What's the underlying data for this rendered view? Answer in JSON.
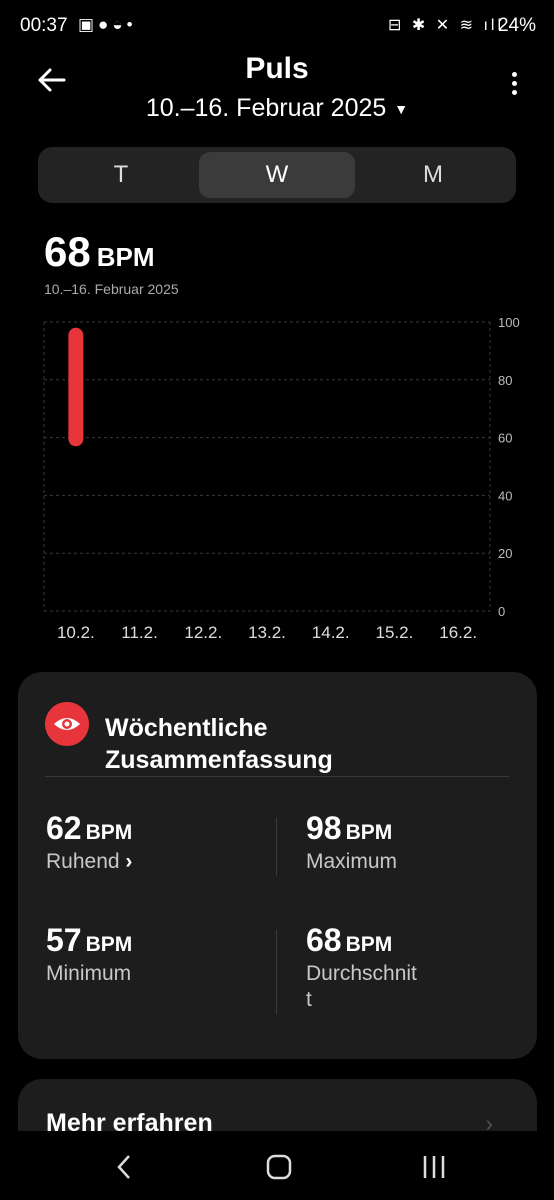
{
  "status": {
    "time": "00:37",
    "battery": "24%"
  },
  "header": {
    "title": "Puls",
    "date_range": "10.–16. Februar 2025"
  },
  "segments": [
    "T",
    "W",
    "M"
  ],
  "summary": {
    "value": "68",
    "unit": "BPM",
    "subtitle": "10.–16. Februar 2025"
  },
  "chart_data": {
    "type": "bar",
    "categories": [
      "10.2.",
      "11.2.",
      "12.2.",
      "13.2.",
      "14.2.",
      "15.2.",
      "16.2."
    ],
    "ranges": [
      [
        57,
        98
      ],
      null,
      null,
      null,
      null,
      null,
      null
    ],
    "yticks": [
      100,
      80,
      60,
      40,
      20,
      0
    ],
    "ylim": [
      0,
      100
    ],
    "bar_color": "#e8353c"
  },
  "weekly": {
    "title_line1": "Wöchentliche",
    "title_line2": "Zusammenfassung",
    "resting": {
      "value": "62",
      "unit": "BPM",
      "label": "Ruhend",
      "chevron": "›"
    },
    "maximum": {
      "value": "98",
      "unit": "BPM",
      "label": "Maximum"
    },
    "minimum": {
      "value": "57",
      "unit": "BPM",
      "label": "Minimum"
    },
    "average": {
      "value": "68",
      "unit": "BPM",
      "label": "Durchschnit",
      "label_wrap": "t"
    }
  },
  "more": {
    "label": "Mehr erfahren",
    "chevron": "›"
  },
  "icons": {
    "accent": "#e8353c"
  }
}
